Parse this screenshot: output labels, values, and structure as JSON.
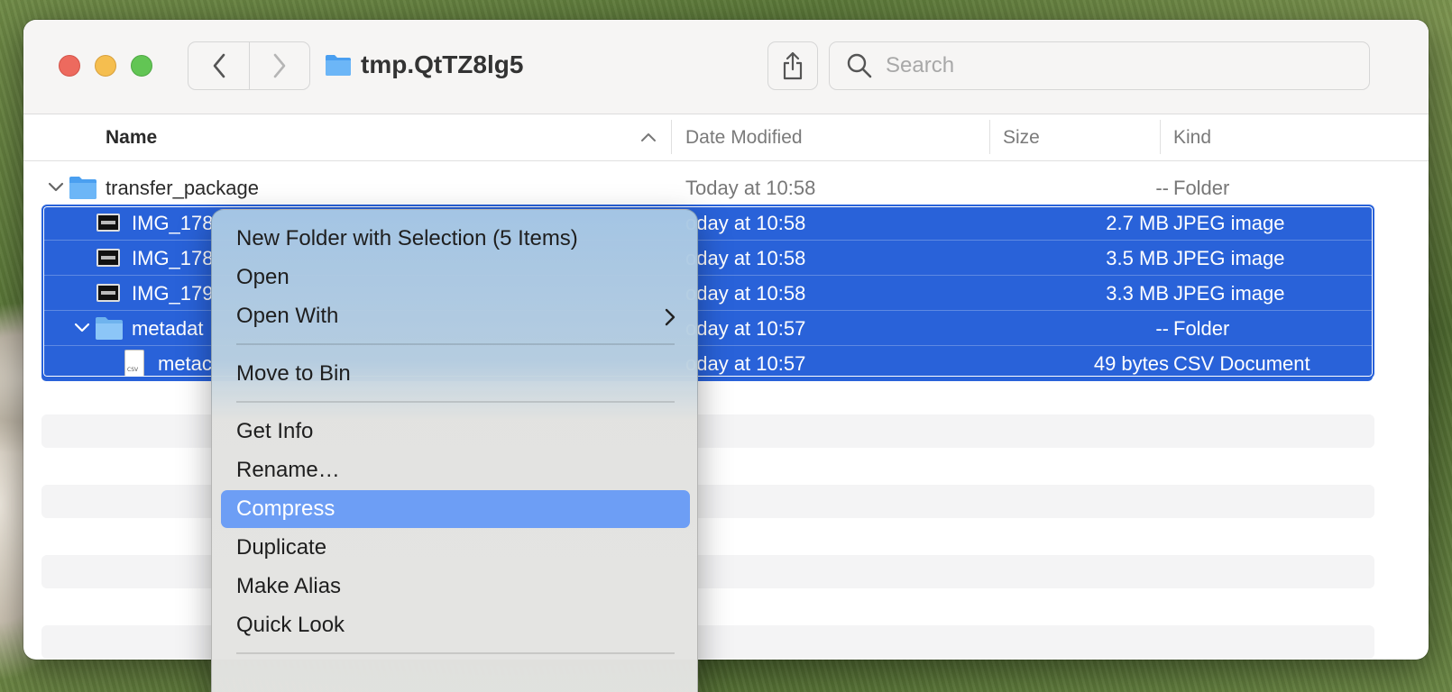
{
  "window": {
    "title": "tmp.QtTZ8lg5"
  },
  "search": {
    "placeholder": "Search"
  },
  "columns": {
    "name": "Name",
    "date": "Date Modified",
    "size": "Size",
    "kind": "Kind"
  },
  "rows": [
    {
      "name": "transfer_package",
      "date": "Today at 10:58",
      "size": "--",
      "kind": "Folder"
    },
    {
      "name": "IMG_178",
      "date": "oday at 10:58",
      "size": "2.7 MB",
      "kind": "JPEG image"
    },
    {
      "name": "IMG_178",
      "date": "oday at 10:58",
      "size": "3.5 MB",
      "kind": "JPEG image"
    },
    {
      "name": "IMG_179",
      "date": "oday at 10:58",
      "size": "3.3 MB",
      "kind": "JPEG image"
    },
    {
      "name": "metadat",
      "date": "oday at 10:57",
      "size": "--",
      "kind": "Folder"
    },
    {
      "name": "metac",
      "date": "oday at 10:57",
      "size": "49 bytes",
      "kind": "CSV Document"
    }
  ],
  "doc_icon_label": "CSV",
  "context_menu": {
    "items": [
      "New Folder with Selection (5 Items)",
      "Open",
      "Open With",
      "Move to Bin",
      "Get Info",
      "Rename…",
      "Compress",
      "Duplicate",
      "Make Alias",
      "Quick Look"
    ],
    "highlighted": "Compress"
  },
  "colors": {
    "selection": "#2962d9",
    "menu_highlight": "#6d9ef5",
    "folder": "#5eaef0"
  }
}
